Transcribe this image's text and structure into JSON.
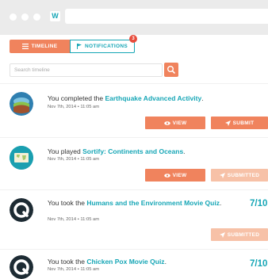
{
  "browser": {
    "favicon": "W"
  },
  "tabs": {
    "timeline_label": "TIMELINE",
    "notifications_label": "NOTIFICATIONS",
    "notifications_count": "3"
  },
  "search": {
    "placeholder": "Search timeline"
  },
  "items": [
    {
      "text_prefix": "You completed the ",
      "link": "Earthquake Advanced Activity",
      "text_suffix": ".",
      "date": "Nov 7th, 2014 • 11:05 am",
      "view_label": "VIEW",
      "submit_label": "SUBMIT"
    },
    {
      "text_prefix": "You played ",
      "link": "Sortify: Continents and Oceans",
      "text_suffix": ".",
      "date": "Nov 7th, 2014 • 11:05 am",
      "view_label": "VIEW",
      "submit_label": "SUBMITTED"
    },
    {
      "text_prefix": "You took the ",
      "link": "Humans and the Environment Movie Quiz",
      "text_suffix": ".",
      "date": "Nov 7th, 2014 • 11:05 am",
      "score": "7/10",
      "submit_label": "SUBMITTED"
    },
    {
      "text_prefix": "You took the ",
      "link": "Chicken Pox Movie Quiz",
      "text_suffix": ".",
      "date": "Nov 7th, 2014 • 11:05 am",
      "score": "7/10"
    }
  ],
  "colors": {
    "accent": "#f0835d",
    "accent_disabled": "#f7c1a7",
    "teal": "#16a6b6",
    "badge": "#e74c3c"
  }
}
